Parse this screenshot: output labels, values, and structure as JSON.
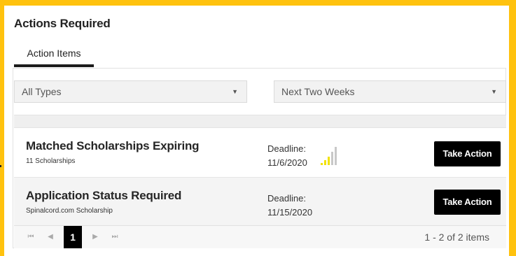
{
  "header": {
    "title": "Actions Required"
  },
  "tabs": [
    {
      "label": "Action Items",
      "active": true
    }
  ],
  "filters": {
    "type": {
      "selected": "All Types"
    },
    "range": {
      "selected": "Next Two Weeks"
    }
  },
  "rows": [
    {
      "title": "Matched Scholarships Expiring",
      "subtitle": "11 Scholarships",
      "deadline_label": "Deadline:",
      "deadline_date": "11/6/2020",
      "urgency_icon": "signal-strength-icon",
      "urgency_level": 0.6,
      "action_label": "Take Action"
    },
    {
      "title": "Application Status Required",
      "subtitle": "Spinalcord.com Scholarship",
      "deadline_label": "Deadline:",
      "deadline_date": "11/15/2020",
      "action_label": "Take Action"
    }
  ],
  "pager": {
    "first_icon": "first-page-icon",
    "prev_icon": "prev-page-icon",
    "current_page": "1",
    "next_icon": "next-page-icon",
    "last_icon": "last-page-icon",
    "info": "1 - 2 of 2 items"
  },
  "colors": {
    "frame": "#ffc20e",
    "signal_active": "#f2e200",
    "signal_inactive": "#c8c8c8",
    "button": "#000000"
  }
}
